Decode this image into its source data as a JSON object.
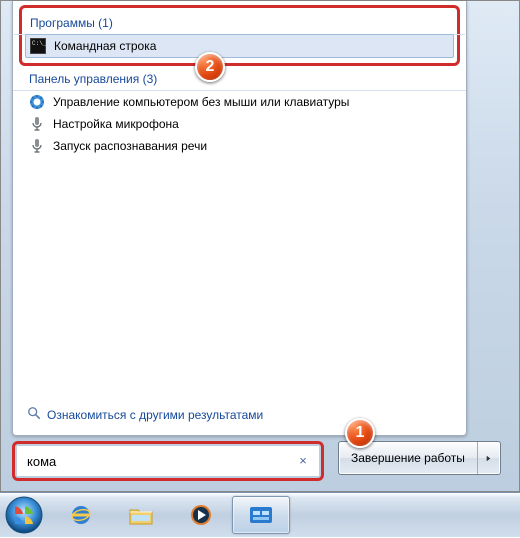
{
  "programs": {
    "header": "Программы (1)",
    "items": [
      {
        "label": "Командная строка"
      }
    ]
  },
  "control_panel": {
    "header": "Панель управления (3)",
    "items": [
      {
        "label": "Управление компьютером без мыши или клавиатуры",
        "icon": "ease-of-access-icon"
      },
      {
        "label": "Настройка микрофона",
        "icon": "microphone-icon"
      },
      {
        "label": "Запуск распознавания речи",
        "icon": "microphone-icon"
      }
    ]
  },
  "see_more": "Ознакомиться с другими результатами",
  "search": {
    "value": "кома",
    "clear": "×"
  },
  "shutdown": {
    "label": "Завершение работы"
  },
  "callouts": {
    "one": "1",
    "two": "2"
  }
}
